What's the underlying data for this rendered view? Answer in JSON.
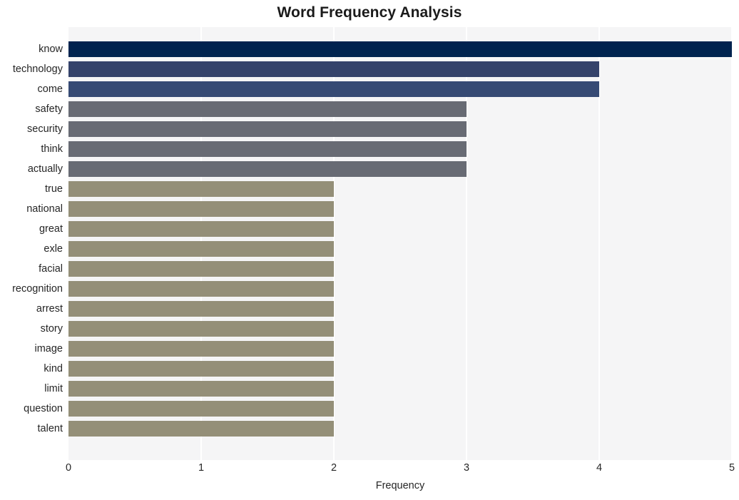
{
  "chart_data": {
    "type": "bar",
    "orientation": "horizontal",
    "title": "Word Frequency Analysis",
    "xlabel": "Frequency",
    "ylabel": "",
    "xlim": [
      0,
      5
    ],
    "xticks": [
      0,
      1,
      2,
      3,
      4,
      5
    ],
    "xtick_labels": [
      "0",
      "1",
      "2",
      "3",
      "4",
      "5"
    ],
    "grid": true,
    "grid_axis": "both",
    "legend": "none",
    "categories": [
      "know",
      "technology",
      "come",
      "safety",
      "security",
      "think",
      "actually",
      "true",
      "national",
      "great",
      "exle",
      "facial",
      "recognition",
      "arrest",
      "story",
      "image",
      "kind",
      "limit",
      "question",
      "talent"
    ],
    "values": [
      5,
      4,
      4,
      3,
      3,
      3,
      3,
      2,
      2,
      2,
      2,
      2,
      2,
      2,
      2,
      2,
      2,
      2,
      2,
      2
    ],
    "bar_colors": [
      "#00234f",
      "#35436b",
      "#364a74",
      "#686b74",
      "#686b74",
      "#686b74",
      "#686b74",
      "#948f78",
      "#948f78",
      "#948f78",
      "#948f78",
      "#948f78",
      "#948f78",
      "#948f78",
      "#948f78",
      "#948f78",
      "#948f78",
      "#948f78",
      "#948f78",
      "#948f78"
    ],
    "plot_background": "#f5f5f6",
    "gridline_color": "#ffffff",
    "figure_background": "#ffffff",
    "title_color": "#1a1a1a",
    "tick_color": "#262626"
  }
}
